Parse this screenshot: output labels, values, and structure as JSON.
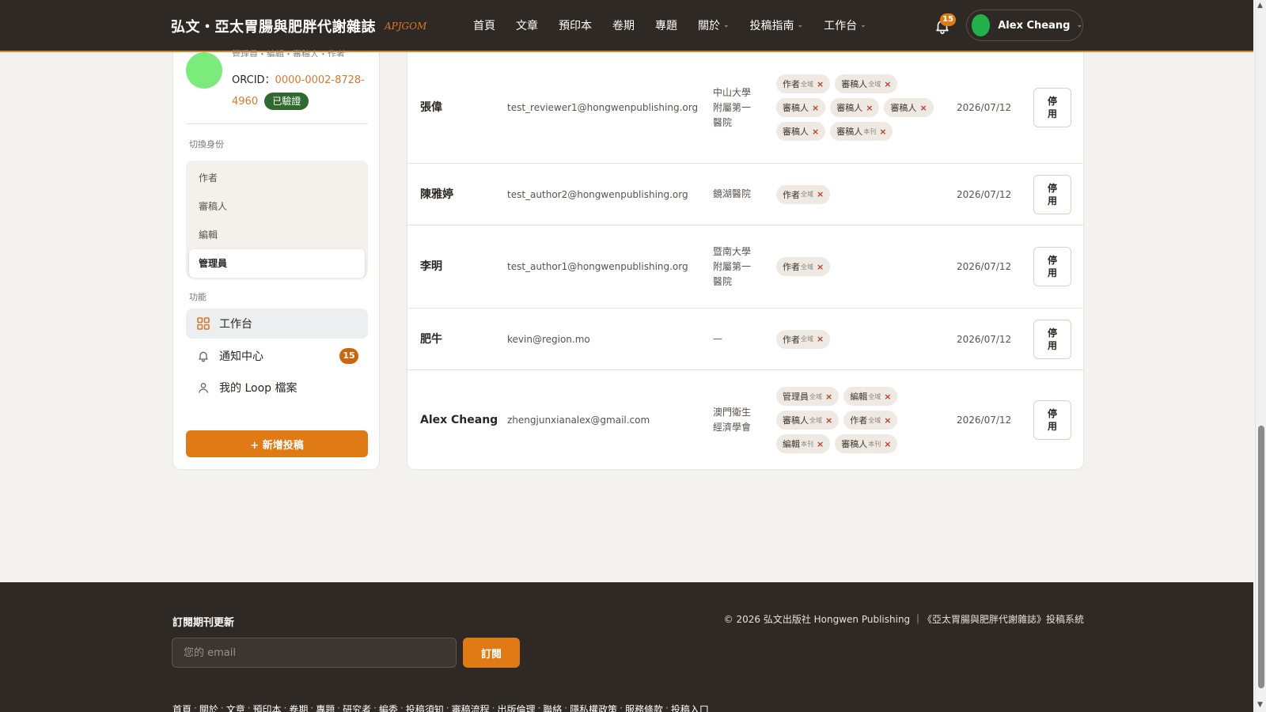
{
  "header": {
    "brand": "弘文・亞太胃腸與肥胖代謝雜誌",
    "brand_sub": "APJGOM",
    "nav": [
      {
        "label": "首頁",
        "has_menu": false
      },
      {
        "label": "文章",
        "has_menu": false
      },
      {
        "label": "預印本",
        "has_menu": false
      },
      {
        "label": "卷期",
        "has_menu": false
      },
      {
        "label": "專題",
        "has_menu": false
      },
      {
        "label": "關於",
        "has_menu": true
      },
      {
        "label": "投稿指南",
        "has_menu": true
      },
      {
        "label": "工作台",
        "has_menu": true
      }
    ],
    "notification_count": "15",
    "user_name": "Alex Cheang"
  },
  "sidebar": {
    "roles_line": "管理員・編輯・審稿人・作者",
    "orcid_label": "ORCID：",
    "orcid_value": "0000-0002-8728-4960",
    "verified_badge": "已驗證",
    "switch_label": "切換身份",
    "roles": [
      "作者",
      "審稿人",
      "編輯",
      "管理員"
    ],
    "active_role": "管理員",
    "function_label": "功能",
    "functions": [
      {
        "label": "工作台",
        "icon": "grid-icon",
        "badge": ""
      },
      {
        "label": "通知中心",
        "icon": "bell-icon",
        "badge": "15"
      },
      {
        "label": "我的 Loop 檔案",
        "icon": "user-icon",
        "badge": ""
      }
    ],
    "new_submission": "+ 新增投稿"
  },
  "users": [
    {
      "name": "張偉",
      "email": "test_reviewer1@hongwenpublishing.org",
      "institution": "中山大學附屬第一醫院",
      "tags": [
        {
          "role": "作者",
          "scope": "全域"
        },
        {
          "role": "審稿人",
          "scope": "全域"
        },
        {
          "role": "審稿人",
          "scope": ""
        },
        {
          "role": "審稿人",
          "scope": ""
        },
        {
          "role": "審稿人",
          "scope": ""
        },
        {
          "role": "審稿人",
          "scope": ""
        },
        {
          "role": "審稿人",
          "scope": "本刊"
        }
      ],
      "date": "2026/07/12",
      "action": "停用"
    },
    {
      "name": "陳雅婷",
      "email": "test_author2@hongwenpublishing.org",
      "institution": "鏡湖醫院",
      "tags": [
        {
          "role": "作者",
          "scope": "全域"
        }
      ],
      "date": "2026/07/12",
      "action": "停用"
    },
    {
      "name": "李明",
      "email": "test_author1@hongwenpublishing.org",
      "institution": "暨南大學附屬第一醫院",
      "tags": [
        {
          "role": "作者",
          "scope": "全域"
        }
      ],
      "date": "2026/07/12",
      "action": "停用"
    },
    {
      "name": "肥牛",
      "email": "kevin@region.mo",
      "institution": "—",
      "tags": [
        {
          "role": "作者",
          "scope": "全域"
        }
      ],
      "date": "2026/07/12",
      "action": "停用"
    },
    {
      "name": "Alex Cheang",
      "email": "zhengjunxianalex@gmail.com",
      "institution": "澳門衛生經濟學會",
      "tags": [
        {
          "role": "管理員",
          "scope": "全域"
        },
        {
          "role": "編輯",
          "scope": "全域"
        },
        {
          "role": "審稿人",
          "scope": "全域"
        },
        {
          "role": "作者",
          "scope": "全域"
        },
        {
          "role": "編輯",
          "scope": "本刊"
        },
        {
          "role": "審稿人",
          "scope": "本刊"
        }
      ],
      "date": "2026/07/12",
      "action": "停用"
    }
  ],
  "footer": {
    "subscribe_title": "訂閱期刊更新",
    "email_placeholder": "您的 email",
    "subscribe_button": "訂閱",
    "copyright": "© 2026 弘文出版社 Hongwen Publishing ｜《亞太胃腸與肥胖代謝雜誌》投稿系統",
    "links": [
      "首頁",
      "關於",
      "文章",
      "預印本",
      "卷期",
      "專題",
      "研究者",
      "編委",
      "投稿須知",
      "審稿流程",
      "出版倫理",
      "聯絡",
      "隱私權政策",
      "服務條款",
      "投稿入口"
    ]
  },
  "colors": {
    "accent": "#e07a14",
    "header_bg": "#2f2925",
    "verified": "#2f6a2e",
    "remove_x": "#c0392b"
  }
}
